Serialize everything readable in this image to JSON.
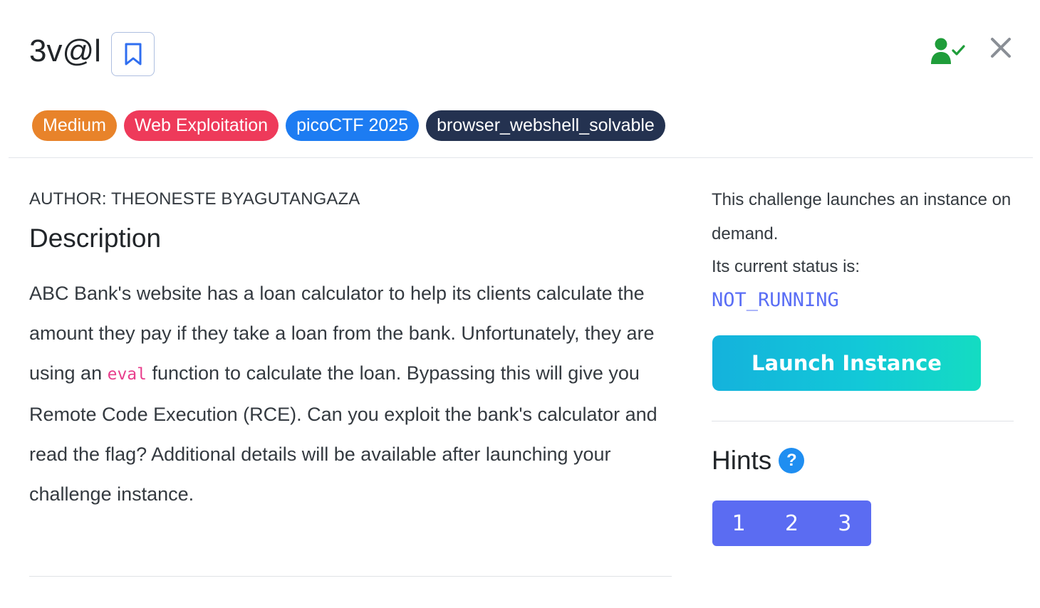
{
  "challenge": {
    "title": "3v@l",
    "tags": [
      {
        "label": "Medium",
        "color": "#e8832a"
      },
      {
        "label": "Web Exploitation",
        "color": "#ee3a5a"
      },
      {
        "label": "picoCTF 2025",
        "color": "#1d7cf2"
      },
      {
        "label": "browser_webshell_solvable",
        "color": "#243250"
      }
    ],
    "icons": {
      "bookmark": "bookmark-icon",
      "solved": "user-check-icon",
      "close": "close-icon"
    }
  },
  "main": {
    "author": "AUTHOR: THEONESTE BYAGUTANGAZA",
    "description_heading": "Description",
    "description_before_code": "ABC Bank's website has a loan calculator to help its clients calculate the amount they pay if they take a loan from the bank. Unfortunately, they are using an ",
    "description_code": "eval",
    "description_after_code": " function to calculate the loan. Bypassing this will give you Remote Code Execution (RCE). Can you exploit the bank's calculator and read the flag? Additional details will be available after launching your challenge instance."
  },
  "sidebar": {
    "instance_info": "This challenge launches an instance on demand.",
    "status_label": "Its current status is:",
    "status_value": "NOT_RUNNING",
    "launch_button": "Launch Instance",
    "hints_heading": "Hints",
    "hints": [
      "1",
      "2",
      "3"
    ]
  }
}
